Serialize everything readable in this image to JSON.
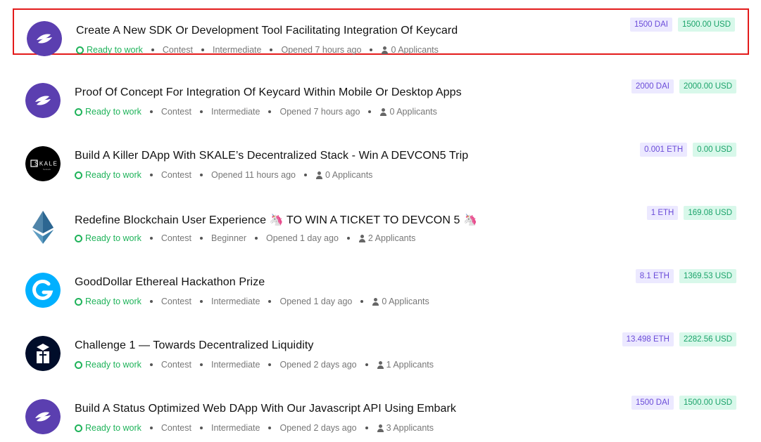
{
  "bounties": [
    {
      "title": "Create A New SDK Or Development Tool Facilitating Integration Of Keycard",
      "status": "Ready to work",
      "meta": [
        "Contest",
        "Intermediate",
        "Opened 7 hours ago"
      ],
      "applicants": "0 Applicants",
      "crypto_amount": "1500 DAI",
      "usd_amount": "1500.00 USD",
      "avatar_icon": "status-logo-icon",
      "selected": true
    },
    {
      "title": "Proof Of Concept For Integration Of Keycard Within Mobile Or Desktop Apps",
      "status": "Ready to work",
      "meta": [
        "Contest",
        "Intermediate",
        "Opened 7 hours ago"
      ],
      "applicants": "0 Applicants",
      "crypto_amount": "2000 DAI",
      "usd_amount": "2000.00 USD",
      "avatar_icon": "status-logo-icon",
      "selected": false
    },
    {
      "title": "Build A Killer DApp With SKALE’s Decentralized Stack - Win A DEVCON5 Trip",
      "status": "Ready to work",
      "meta": [
        "Contest",
        "Opened 11 hours ago"
      ],
      "applicants": "0 Applicants",
      "crypto_amount": "0.001 ETH",
      "usd_amount": "0.00 USD",
      "avatar_icon": "skale-logo-icon",
      "avatar_text": "SKALE",
      "selected": false
    },
    {
      "title": "Redefine Blockchain User Experience 🦄 TO WIN A TICKET TO DEVCON 5 🦄",
      "status": "Ready to work",
      "meta": [
        "Contest",
        "Beginner",
        "Opened 1 day ago"
      ],
      "applicants": "2 Applicants",
      "crypto_amount": "1 ETH",
      "usd_amount": "169.08 USD",
      "avatar_icon": "ethereum-logo-icon",
      "selected": false
    },
    {
      "title": "GoodDollar Ethereal Hackathon Prize",
      "status": "Ready to work",
      "meta": [
        "Contest",
        "Intermediate",
        "Opened 1 day ago"
      ],
      "applicants": "0 Applicants",
      "crypto_amount": "8.1 ETH",
      "usd_amount": "1369.53 USD",
      "avatar_icon": "gooddollar-logo-icon",
      "selected": false
    },
    {
      "title": "Challenge 1 — Towards Decentralized Liquidity",
      "status": "Ready to work",
      "meta": [
        "Contest",
        "Intermediate",
        "Opened 2 days ago"
      ],
      "applicants": "1 Applicants",
      "crypto_amount": "13.498 ETH",
      "usd_amount": "2282.56 USD",
      "avatar_icon": "bancor-logo-icon",
      "selected": false
    },
    {
      "title": "Build A Status Optimized Web DApp With Our Javascript API Using Embark",
      "status": "Ready to work",
      "meta": [
        "Contest",
        "Intermediate",
        "Opened 2 days ago"
      ],
      "applicants": "3 Applicants",
      "crypto_amount": "1500 DAI",
      "usd_amount": "1500.00 USD",
      "avatar_icon": "status-logo-icon",
      "selected": false
    }
  ],
  "colors": {
    "selection_border": "#e31b1b",
    "status_green": "#1fb35a",
    "crypto_badge_bg": "#ece9ff",
    "crypto_badge_text": "#6a4bd8",
    "usd_badge_bg": "#d8f8ea",
    "usd_badge_text": "#1ba36a",
    "status_logo": "#5b3fb0"
  }
}
